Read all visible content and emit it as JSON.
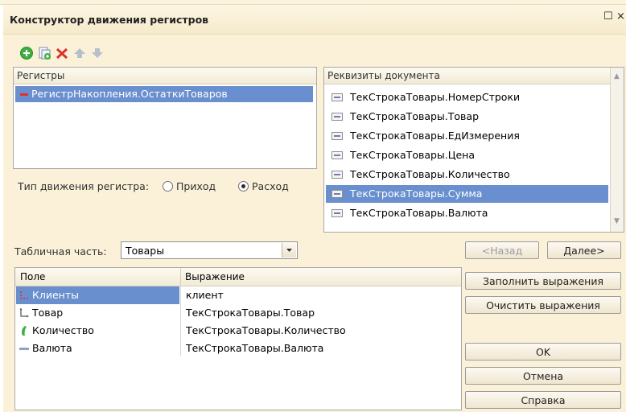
{
  "window": {
    "title": "Конструктор движения регистров",
    "restore_glyph": "☐",
    "close_glyph": "×"
  },
  "toolbar": [
    {
      "name": "add-icon",
      "glyph": "+"
    },
    {
      "name": "copy-icon",
      "glyph": ""
    },
    {
      "name": "delete-icon",
      "glyph": "✖"
    },
    {
      "name": "move-up-icon",
      "glyph": "▲"
    },
    {
      "name": "move-down-icon",
      "glyph": "▼"
    }
  ],
  "registers": {
    "header": "Регистры",
    "items": [
      {
        "label": "РегистрНакопления.ОстаткиТоваров",
        "selected": true
      }
    ]
  },
  "movement_type": {
    "label": "Тип движения регистра:",
    "options": [
      {
        "label": "Приход",
        "checked": false
      },
      {
        "label": "Расход",
        "checked": true
      }
    ]
  },
  "doc_attributes": {
    "header": "Реквизиты документа",
    "items": [
      {
        "label": "ТекСтрокаТовары.НомерСтроки",
        "selected": false
      },
      {
        "label": "ТекСтрокаТовары.Товар",
        "selected": false
      },
      {
        "label": "ТекСтрокаТовары.ЕдИзмерения",
        "selected": false
      },
      {
        "label": "ТекСтрокаТовары.Цена",
        "selected": false
      },
      {
        "label": "ТекСтрокаТовары.Количество",
        "selected": false
      },
      {
        "label": "ТекСтрокаТовары.Сумма",
        "selected": true
      },
      {
        "label": "ТекСтрокаТовары.Валюта",
        "selected": false
      }
    ]
  },
  "tabular_part": {
    "label": "Табличная часть:",
    "value": "Товары"
  },
  "nav": {
    "back": "<Назад",
    "next": "Далее>"
  },
  "grid": {
    "columns": [
      "Поле",
      "Выражение"
    ],
    "rows": [
      {
        "field": "Клиенты",
        "expr": "клиент",
        "icon": "dimension-icon",
        "selected": true
      },
      {
        "field": "Товар",
        "expr": "ТекСтрокаТовары.Товар",
        "icon": "dimension-icon",
        "selected": false
      },
      {
        "field": "Количество",
        "expr": "ТекСтрокаТовары.Количество",
        "icon": "resource-icon",
        "selected": false
      },
      {
        "field": "Валюта",
        "expr": "ТекСтрокаТовары.Валюта",
        "icon": "attribute-icon",
        "selected": false
      }
    ]
  },
  "actions": {
    "fill": "Заполнить выражения",
    "clear": "Очистить выражения",
    "ok": "OK",
    "cancel": "Отмена",
    "help": "Справка"
  },
  "colors": {
    "selection": "#6a8fcf",
    "window_bg": "#fbf1d8",
    "add_green": "#3fae3f",
    "delete_red": "#d9332b",
    "arrow_gray": "#9aa5b5"
  }
}
